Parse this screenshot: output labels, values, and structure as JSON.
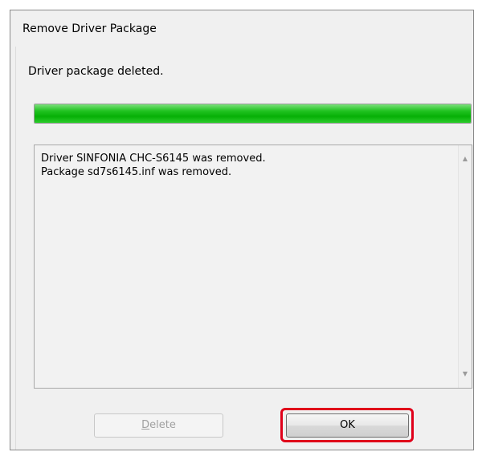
{
  "window": {
    "title": "Remove Driver Package"
  },
  "status_text": "Driver package deleted.",
  "progress": {
    "value_percent": 100,
    "color": "#06b006"
  },
  "log": {
    "lines": [
      "Driver SINFONIA CHC-S6145 was removed.",
      "Package sd7s6145.inf was removed."
    ]
  },
  "buttons": {
    "delete_label_first": "D",
    "delete_label_rest": "elete",
    "ok_label": "OK"
  },
  "highlight_color": "#e0001a",
  "icons": {
    "scroll_up": "▲",
    "scroll_down": "▼"
  }
}
